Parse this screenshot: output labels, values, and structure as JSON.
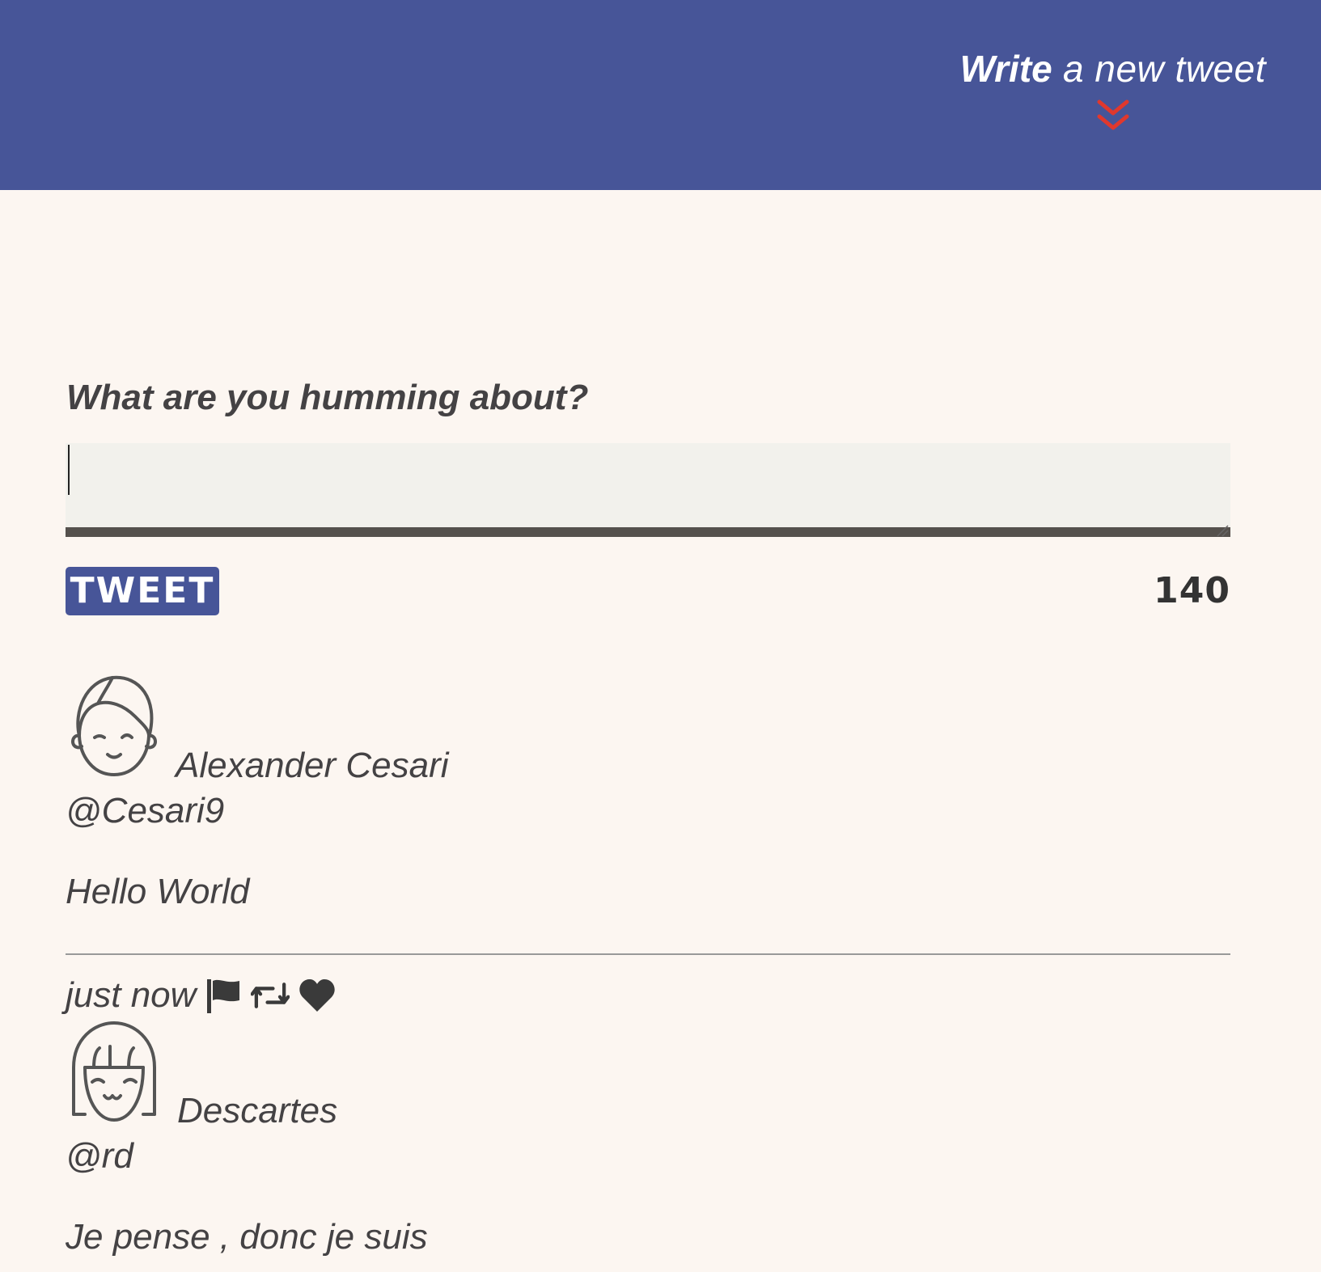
{
  "header": {
    "write_strong": "Write",
    "write_rest": " a new tweet",
    "background_color": "#475598",
    "chevron_color": "#e0382d"
  },
  "compose": {
    "label": "What are you humming about?",
    "textarea_value": "",
    "tweet_button_label": "TWEET",
    "char_count": "140"
  },
  "tweets": [
    {
      "avatar_icon": "boy-avatar-icon",
      "author": "Alexander Cesari",
      "handle": "@Cesari9",
      "text": "Hello World",
      "time": "just now",
      "actions": [
        "flag-icon",
        "retweet-icon",
        "heart-icon"
      ]
    },
    {
      "avatar_icon": "girl-avatar-icon",
      "author": "Descartes",
      "handle": "@rd",
      "text": "Je pense , donc je suis"
    }
  ]
}
